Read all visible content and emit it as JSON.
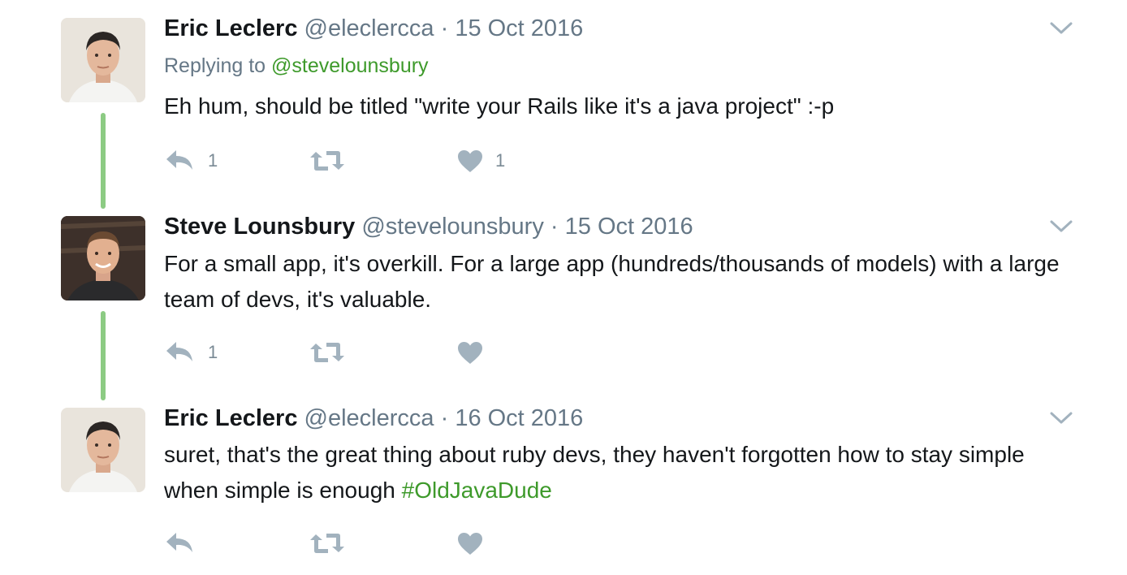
{
  "tweets": [
    {
      "name": "Eric Leclerc",
      "handle": "@eleclercca",
      "separator": "·",
      "date": "15 Oct 2016",
      "replying_prefix": "Replying to ",
      "replying_to": "@stevelounsbury",
      "text": "Eh hum, should be titled \"write your Rails like it's a java project\" :-p",
      "reply_count": "1",
      "retweet_count": "",
      "like_count": "1"
    },
    {
      "name": "Steve Lounsbury",
      "handle": "@stevelounsbury",
      "separator": "·",
      "date": "15 Oct 2016",
      "text": "For a small app, it's overkill. For a large app (hundreds/thousands of models) with a large team of devs, it's valuable.",
      "reply_count": "1",
      "retweet_count": "",
      "like_count": ""
    },
    {
      "name": "Eric Leclerc",
      "handle": "@eleclercca",
      "separator": "·",
      "date": "16 Oct 2016",
      "text": "suret, that's the great thing about ruby devs, they haven't forgotten how to stay simple when simple is enough ",
      "hashtag": "#OldJavaDude",
      "reply_count": "",
      "retweet_count": "",
      "like_count": ""
    }
  ],
  "colors": {
    "thread_line": "#8ccb83",
    "link": "#3e9a2b",
    "muted": "#657786",
    "icon": "#a2b2be"
  },
  "icons": {
    "reply": "reply-icon",
    "retweet": "retweet-icon",
    "like": "heart-icon",
    "more": "chevron-down-icon"
  }
}
